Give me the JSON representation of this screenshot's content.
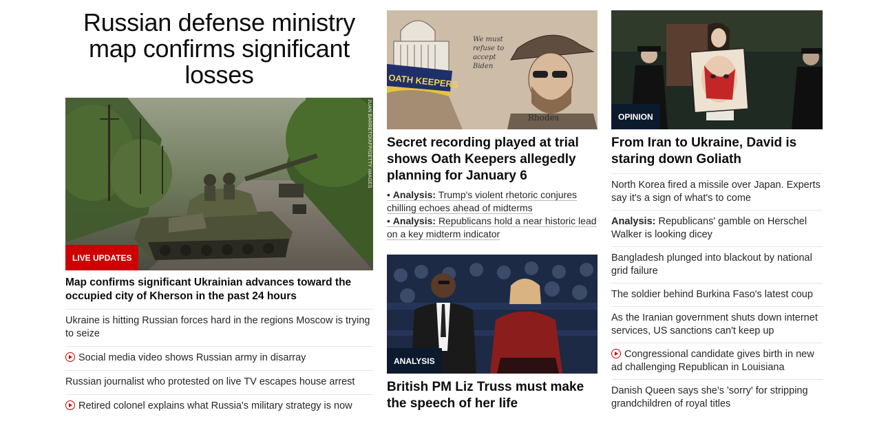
{
  "left": {
    "hero_title": "Russian defense ministry map confirms significant losses",
    "image_credit": "JUAN BARRETO/AFP/GETTY IMAGES",
    "badge": "LIVE UPDATES",
    "lead_headline": "Map confirms significant Ukrainian advances toward the occupied city of Kherson in the past 24 hours",
    "items": [
      {
        "text": "Ukraine is hitting Russian forces hard in the regions Moscow is trying to seize",
        "video": false
      },
      {
        "text": "Social media video shows Russian army in disarray",
        "video": true
      },
      {
        "text": "Russian journalist who protested on live TV escapes house arrest",
        "video": false
      },
      {
        "text": "Retired colonel explains what Russia's military strategy is now",
        "video": true
      }
    ]
  },
  "middle": {
    "card1": {
      "headline": "Secret recording played at trial shows Oath Keepers allegedly planning for January 6",
      "sketch_banner": "OATH KEEPERS",
      "sketch_quote": "We must refuse to accept Biden",
      "sketch_name": "Rhodes",
      "analysis": [
        {
          "label": "Analysis:",
          "text": "Trump's violent rhetoric conjures chilling echoes ahead of midterms"
        },
        {
          "label": "Analysis:",
          "text": "Republicans hold a near historic lead on a key midterm indicator"
        }
      ]
    },
    "card2": {
      "badge": "ANALYSIS",
      "headline": "British PM Liz Truss must make the speech of her life"
    }
  },
  "right": {
    "badge": "OPINION",
    "headline": "From Iran to Ukraine, David is staring down Goliath",
    "items": [
      {
        "label": "",
        "text": "North Korea fired a missile over Japan. Experts say it's a sign of what's to come",
        "video": false
      },
      {
        "label": "Analysis:",
        "text": "Republicans' gamble on Herschel Walker is looking dicey",
        "video": false
      },
      {
        "label": "",
        "text": "Bangladesh plunged into blackout by national grid failure",
        "video": false
      },
      {
        "label": "",
        "text": "The soldier behind Burkina Faso's latest coup",
        "video": false
      },
      {
        "label": "",
        "text": "As the Iranian government shuts down internet services, US sanctions can't keep up",
        "video": false
      },
      {
        "label": "",
        "text": "Congressional candidate gives birth in new ad challenging Republican in Louisiana",
        "video": true
      },
      {
        "label": "",
        "text": "Danish Queen says she's 'sorry' for stripping grandchildren of royal titles",
        "video": false
      }
    ]
  },
  "colors": {
    "live_red": "#cc0000",
    "badge_dark": "#0c1a2e",
    "divider": "#e6e6e6"
  }
}
